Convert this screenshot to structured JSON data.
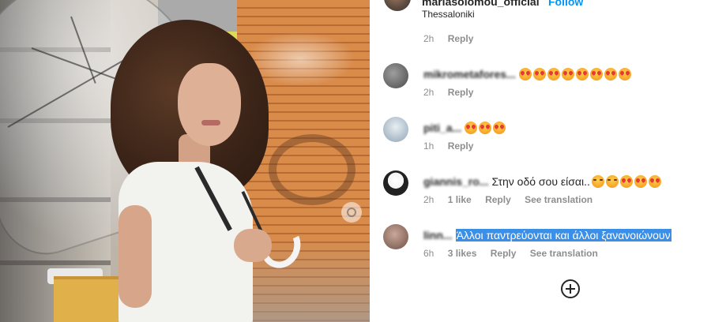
{
  "post": {
    "username": "mariasolomou_official",
    "follow_label": "Follow",
    "location": "Thessaloniki"
  },
  "top_meta": {
    "time": "2h",
    "reply": "Reply"
  },
  "comments": [
    {
      "username": "mikrometafores...",
      "text": "",
      "emoji_count": 8,
      "emoji": "star-struck",
      "time": "2h",
      "likes": "",
      "reply": "Reply",
      "translation": ""
    },
    {
      "username": "piti_a...",
      "text": "",
      "emoji_count": 3,
      "emoji": "star-struck",
      "time": "1h",
      "likes": "",
      "reply": "Reply",
      "translation": ""
    },
    {
      "username": "giannis_ro...",
      "text": "Στην οδό σου είσαι..",
      "emoji_count": 5,
      "emoji": "laughing",
      "time": "2h",
      "likes": "1 like",
      "reply": "Reply",
      "translation": "See translation"
    },
    {
      "username": "linn...",
      "text": "Άλλοι παντρεύονται και άλλοι ξανανοιώνουν",
      "emoji_count": 0,
      "emoji": "",
      "time": "6h",
      "likes": "3 likes",
      "reply": "Reply",
      "translation": "See translation"
    }
  ],
  "load_more_icon": "plus-circle-icon",
  "colors": {
    "follow": "#0095f6",
    "highlight": "#3b8fe6",
    "meta": "#8e8e8e"
  }
}
